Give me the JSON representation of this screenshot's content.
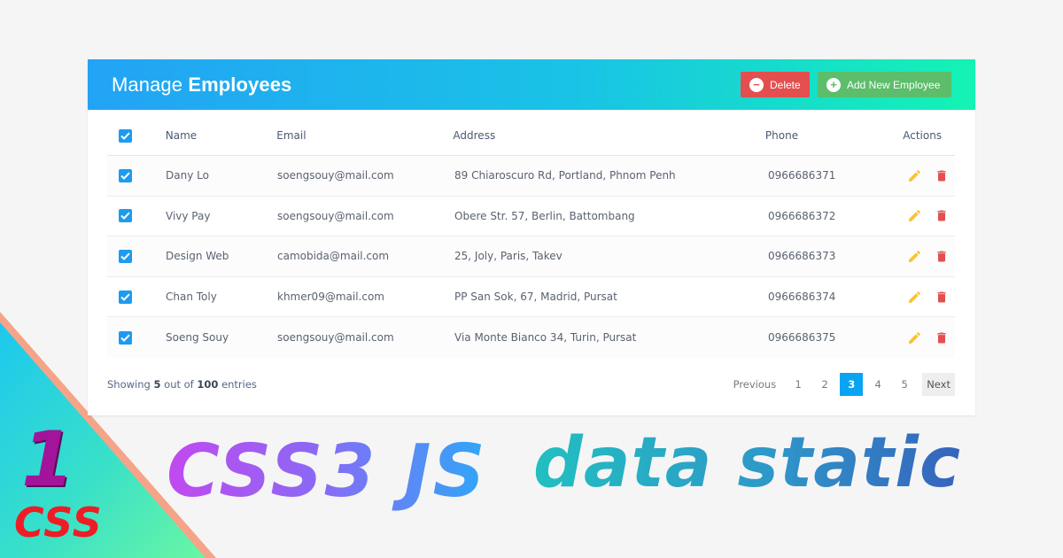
{
  "header": {
    "title_light": "Manage",
    "title_bold": "Employees",
    "delete_label": "Delete",
    "add_label": "Add New Employee"
  },
  "table": {
    "columns": [
      "Name",
      "Email",
      "Address",
      "Phone",
      "Actions"
    ],
    "rows": [
      {
        "name": "Dany Lo",
        "email": "soengsouy@mail.com",
        "address": "89 Chiaroscuro Rd, Portland, Phnom Penh",
        "phone": "0966686371"
      },
      {
        "name": "Vivy Pay",
        "email": "soengsouy@mail.com",
        "address": "Obere Str. 57, Berlin, Battombang",
        "phone": "0966686372"
      },
      {
        "name": "Design Web",
        "email": "camobida@mail.com",
        "address": "25, Joly, Paris, Takev",
        "phone": "0966686373"
      },
      {
        "name": "Chan Toly",
        "email": "khmer09@mail.com",
        "address": "PP San Sok, 67, Madrid, Pursat",
        "phone": "0966686374"
      },
      {
        "name": "Soeng Souy",
        "email": "soengsouy@mail.com",
        "address": "Via Monte Bianco 34, Turin, Pursat",
        "phone": "0966686375"
      }
    ]
  },
  "footer": {
    "showing": "Showing",
    "count": "5",
    "out_of": "out of",
    "total": "100",
    "entries": "entries"
  },
  "pagination": {
    "previous": "Previous",
    "pages": [
      "1",
      "2",
      "3",
      "4",
      "5"
    ],
    "active_page": "3",
    "next": "Next"
  },
  "banner": {
    "number": "1",
    "badge": "CSS",
    "headline_left": "CSS3 JS",
    "headline_right": "data static"
  },
  "colors": {
    "accent": "#08a4f2",
    "checkbox": "#1c9bf0",
    "delete": "#e34f4f",
    "add": "#5cbd6a",
    "edit_icon": "#fcc22d",
    "trash_icon": "#e34f4f"
  },
  "icons": {
    "delete_button": "minus-circle-icon",
    "add_button": "plus-circle-icon",
    "edit": "pencil-icon",
    "delete_row": "trash-icon",
    "checkbox": "checkmark-icon"
  }
}
